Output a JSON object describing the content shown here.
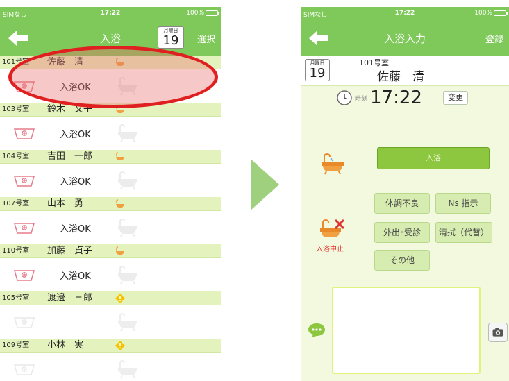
{
  "colors": {
    "header_green": "#7ec95a",
    "room_row": "#e4f3bd",
    "bath_button": "#8dc63f",
    "highlight_red": "#e02020"
  },
  "left": {
    "status": {
      "carrier": "SIMなし",
      "time": "17:22",
      "battery": "100%"
    },
    "nav": {
      "title": "入浴",
      "action": "選択",
      "back_icon": "back-arrow-icon"
    },
    "date": {
      "weekday": "月曜日",
      "day": "19"
    },
    "rows": [
      {
        "room": "101号室",
        "name": "佐藤　清",
        "status": "入浴OK",
        "flag": "bath-icon"
      },
      {
        "room": "103号室",
        "name": "鈴木　文子",
        "status": "入浴OK",
        "flag": "bath-icon"
      },
      {
        "room": "104号室",
        "name": "吉田　一郎",
        "status": "入浴OK",
        "flag": "bath-icon"
      },
      {
        "room": "107号室",
        "name": "山本　勇",
        "status": "入浴OK",
        "flag": "bath-icon"
      },
      {
        "room": "110号室",
        "name": "加藤　貞子",
        "status": "入浴OK",
        "flag": "bath-icon"
      },
      {
        "room": "105号室",
        "name": "渡邊　三郎",
        "status": "",
        "flag": "warning-icon"
      },
      {
        "room": "109号室",
        "name": "小林　実",
        "status": "",
        "flag": "warning-icon"
      }
    ]
  },
  "right": {
    "status": {
      "carrier": "SIMなし",
      "time": "17:22",
      "battery": "100%"
    },
    "nav": {
      "title": "入浴入力",
      "action": "登録",
      "back_icon": "back-arrow-icon"
    },
    "date": {
      "weekday": "月曜日",
      "day": "19"
    },
    "room": "101号室",
    "patient_name": "佐藤　清",
    "time_label": "時刻",
    "time_value": "17:22",
    "change_label": "変更",
    "bath_label": "入浴",
    "stop_label": "入浴中止",
    "reasons": [
      "体調不良",
      "Ns 指示",
      "外出･受診",
      "清拭（代替）",
      "その他"
    ]
  }
}
